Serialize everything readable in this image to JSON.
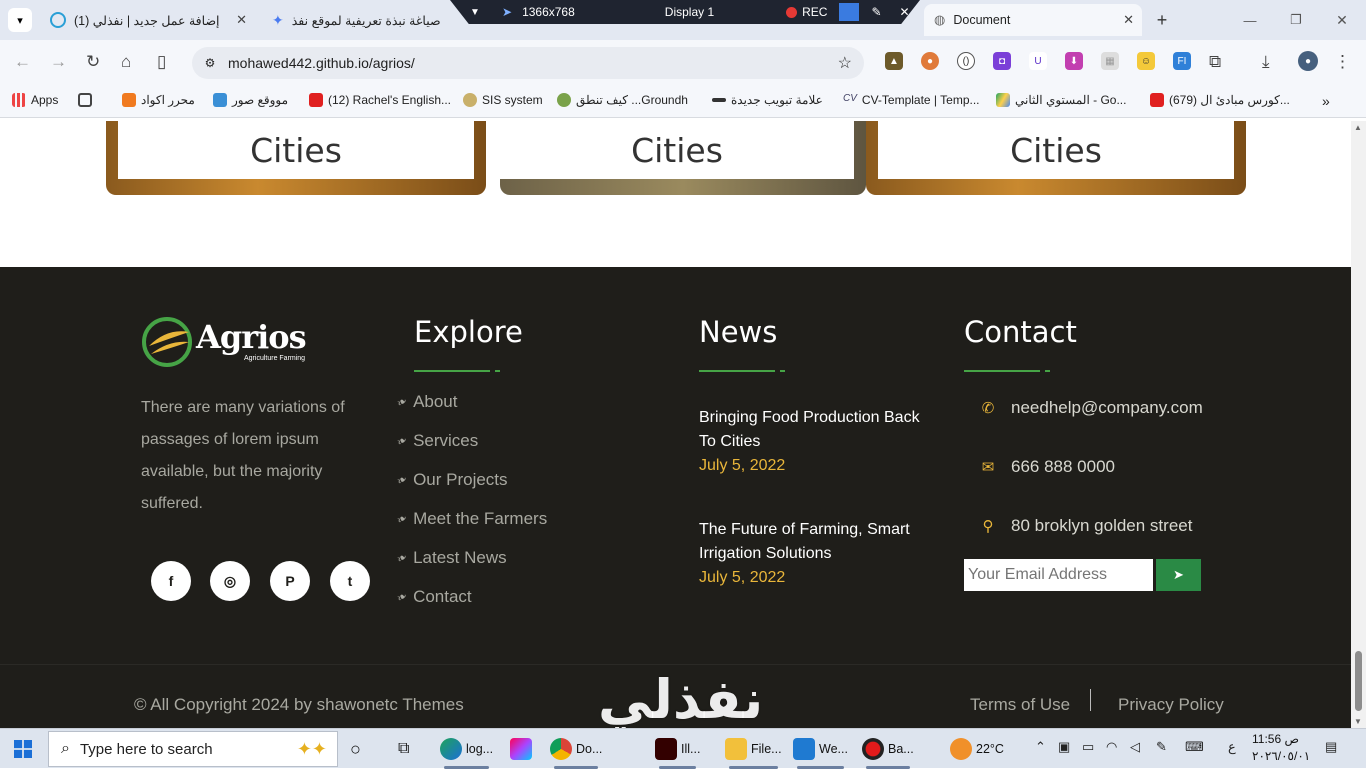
{
  "browser": {
    "tabs": [
      {
        "title": "(1) إضافة عمل جديد | نفذلي"
      },
      {
        "title": "صياغة نبذة تعريفية لموقع نفذ"
      },
      {
        "title": "Document"
      }
    ],
    "recorder": {
      "resolution": "1366x768",
      "display": "Display 1",
      "rec": "REC"
    },
    "url": "mohawed442.github.io/agrios/",
    "bookmarks": [
      "Apps",
      "محرر اكواد",
      "مووقع صور",
      "(12) Rachel's English...",
      "SIS system",
      "كيف تنطق ...Groundh",
      "علامة تبويب جديدة",
      "CV-Template | Temp...",
      "المستوي الثاني - Go...",
      "(679) كورس مبادئ ال..."
    ]
  },
  "cards": [
    {
      "label": "Cities"
    },
    {
      "label": "Cities"
    },
    {
      "label": "Cities"
    }
  ],
  "footer": {
    "logo": {
      "name": "Agrios",
      "tagline": "Agriculture Farming"
    },
    "about_text": "There are many variations of passages of lorem ipsum available, but the majority suffered.",
    "social": [
      {
        "icon": "facebook-icon",
        "glyph": "f"
      },
      {
        "icon": "instagram-icon",
        "glyph": "◎"
      },
      {
        "icon": "pinterest-icon",
        "glyph": "P"
      },
      {
        "icon": "twitter-icon",
        "glyph": "t"
      }
    ],
    "explore": {
      "title": "Explore",
      "links": [
        "About",
        "Services",
        "Our Projects",
        "Meet the Farmers",
        "Latest News",
        "Contact"
      ]
    },
    "news": {
      "title": "News",
      "items": [
        {
          "title": "Bringing Food Production Back To Cities",
          "date": "July 5, 2022"
        },
        {
          "title": "The Future of Farming, Smart Irrigation Solutions",
          "date": "July 5, 2022"
        }
      ]
    },
    "contact": {
      "title": "Contact",
      "email": "needhelp@company.com",
      "phone": "666 888 0000",
      "address": "80 broklyn golden street",
      "email_placeholder": "Your Email Address"
    },
    "copyright": "© All Copyright 2024 by shawonetc Themes",
    "terms": "Terms of Use",
    "privacy": "Privacy Policy"
  },
  "watermark": "نفذلي",
  "taskbar": {
    "search_placeholder": "Type here to search",
    "apps": [
      "log...",
      "Do...",
      "Ill...",
      "File...",
      "We...",
      "Ba..."
    ],
    "weather": "22°C",
    "lang": "ع",
    "time": "11:56 ص",
    "date": "٢٠٢٦/٠٥/٠١"
  },
  "colors": {
    "footer_bg": "#1f1e1a",
    "accent_green": "#46a446",
    "accent_gold": "#e9b63a",
    "send_button": "#2a8a45"
  }
}
